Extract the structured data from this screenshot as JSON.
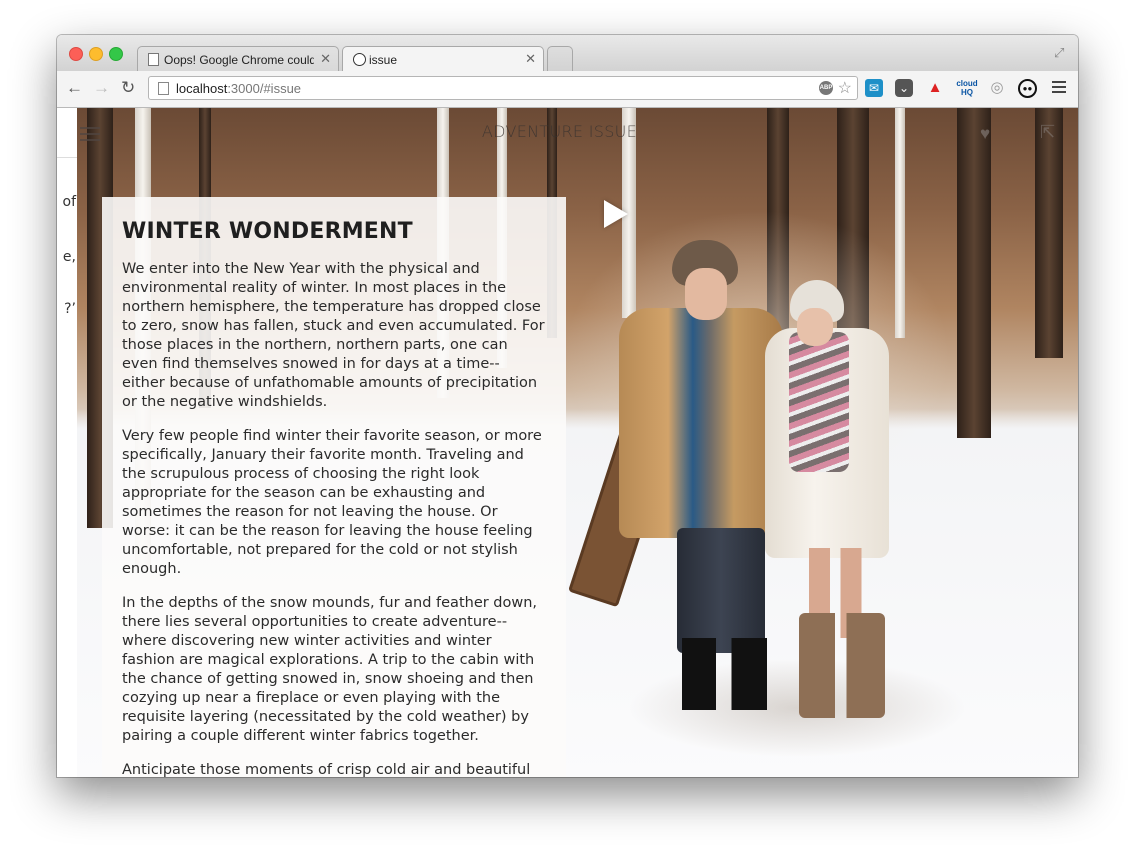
{
  "browser": {
    "tabs": [
      {
        "title": "Oops! Google Chrome could"
      },
      {
        "title": "issue"
      }
    ],
    "url": {
      "host": "localhost",
      "path": ":3000/#issue"
    }
  },
  "sidebar_fragments": [
    "of",
    "e,",
    "?’"
  ],
  "header": {
    "title": "ADVENTURE ISSUE"
  },
  "article": {
    "title": "WINTER WONDERMENT",
    "paragraphs": [
      "We enter into the New Year with the physical and environmental reality of winter. In most places in the northern hemisphere, the temperature has dropped close to zero, snow has fallen, stuck and even accumulated. For those places in the northern, northern parts, one can even find themselves snowed in for days at a time-- either because of unfathomable amounts of precipitation or the negative windshields.",
      "Very few people find winter their favorite season, or more specifically, January their favorite month. Traveling and the scrupulous process of choosing the right look appropriate for the season can be exhausting and sometimes the reason for not leaving the house. Or worse: it can be the reason for leaving the house feeling uncomfortable, not prepared for the cold or not stylish enough.",
      "In the depths of the snow mounds, fur and feather down, there lies several opportunities to create adventure-- where discovering new winter activities and winter fashion are magical explorations. A trip to the cabin with the chance of getting snowed in, snow shoeing and then cozying up near a fireplace or even playing with the requisite layering (necessitated by the cold weather) by pairing a couple different winter fabrics together.",
      "Anticipate those moments of crisp cold air and beautiful white landscapes, the smell of pine and sandalwood with a"
    ]
  },
  "icons": [
    "hamburger-menu-icon",
    "heart-icon",
    "share-icon",
    "play-icon"
  ]
}
